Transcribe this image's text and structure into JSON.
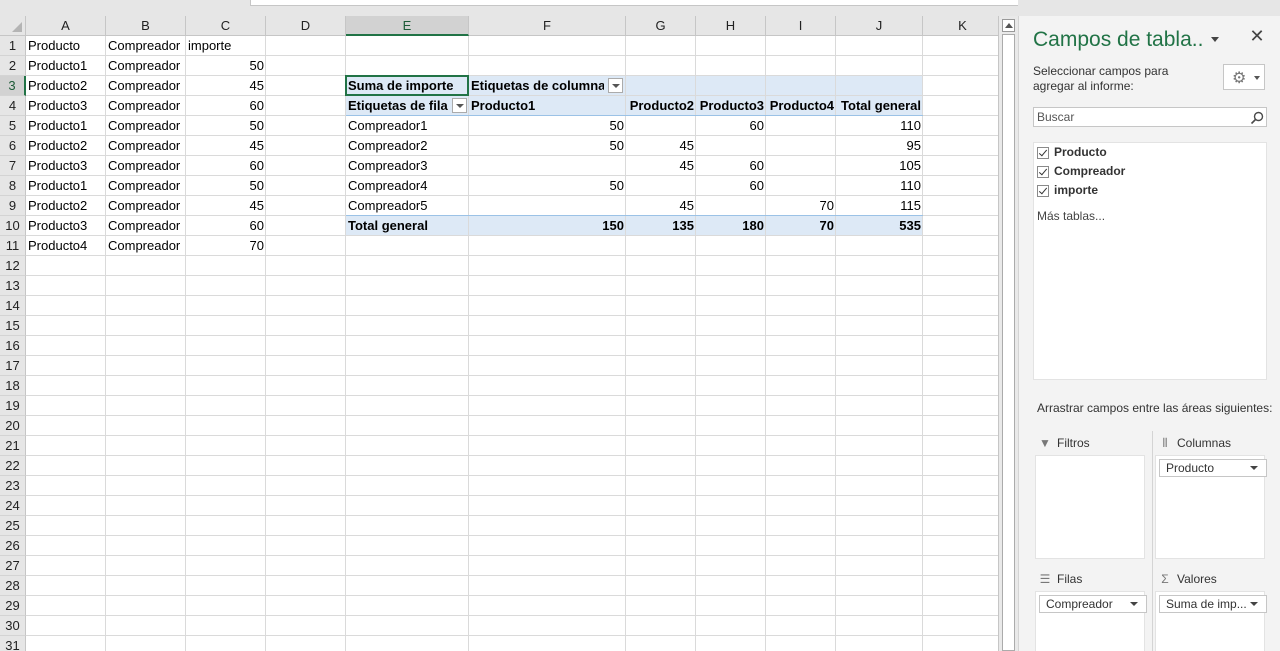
{
  "sheet": {
    "column_headers": [
      "A",
      "B",
      "C",
      "D",
      "E",
      "F",
      "G",
      "H",
      "I",
      "J",
      "K"
    ],
    "selected_column": "E",
    "row_headers": [
      "1",
      "2",
      "3",
      "4",
      "5",
      "6",
      "7",
      "8",
      "9",
      "10",
      "11",
      "12",
      "13",
      "14",
      "15",
      "16",
      "17",
      "18",
      "19",
      "20",
      "21",
      "22",
      "23",
      "24",
      "25",
      "26",
      "27",
      "28",
      "29",
      "30",
      "31"
    ],
    "selected_row": "3",
    "source_table": {
      "headers": [
        "Producto",
        "Compreador",
        "importe"
      ],
      "rows": [
        [
          "Producto1",
          "Compreador",
          "50"
        ],
        [
          "Producto2",
          "Compreador",
          "45"
        ],
        [
          "Producto3",
          "Compreador",
          "60"
        ],
        [
          "Producto1",
          "Compreador",
          "50"
        ],
        [
          "Producto2",
          "Compreador",
          "45"
        ],
        [
          "Producto3",
          "Compreador",
          "60"
        ],
        [
          "Producto1",
          "Compreador",
          "50"
        ],
        [
          "Producto2",
          "Compreador",
          "45"
        ],
        [
          "Producto3",
          "Compreador",
          "60"
        ],
        [
          "Producto4",
          "Compreador",
          "70"
        ]
      ]
    },
    "pivot": {
      "value_label": "Suma de importe",
      "col_labels_label": "Etiquetas de columna",
      "row_labels_label": "Etiquetas de fila",
      "col_headers": [
        "Producto1",
        "Producto2",
        "Producto3",
        "Producto4",
        "Total general"
      ],
      "rows": [
        {
          "label": "Compreador1",
          "values": [
            "50",
            "",
            "60",
            "",
            "110"
          ]
        },
        {
          "label": "Compreador2",
          "values": [
            "50",
            "45",
            "",
            "",
            "95"
          ]
        },
        {
          "label": "Compreador3",
          "values": [
            "",
            "45",
            "60",
            "",
            "105"
          ]
        },
        {
          "label": "Compreador4",
          "values": [
            "50",
            "",
            "60",
            "",
            "110"
          ]
        },
        {
          "label": "Compreador5",
          "values": [
            "",
            "45",
            "",
            "70",
            "115"
          ]
        }
      ],
      "total": {
        "label": "Total general",
        "values": [
          "150",
          "135",
          "180",
          "70",
          "535"
        ]
      }
    }
  },
  "pane": {
    "title": "Campos de tabla..",
    "close_symbol": "✕",
    "subtitle": "Seleccionar campos para agregar al informe:",
    "gear_symbol": "⚙",
    "search_placeholder": "Buscar",
    "fields": [
      {
        "label": "Producto",
        "checked": true
      },
      {
        "label": "Compreador",
        "checked": true
      },
      {
        "label": "importe",
        "checked": true
      }
    ],
    "more_tables": "Más tablas...",
    "drag_text": "Arrastrar campos entre las áreas siguientes:",
    "areas": {
      "filters": {
        "title": "Filtros",
        "icon": "funnel-icon",
        "items": []
      },
      "columns": {
        "title": "Columnas",
        "icon": "columns-icon",
        "items": [
          "Producto"
        ]
      },
      "rows": {
        "title": "Filas",
        "icon": "rows-icon",
        "items": [
          "Compreador"
        ]
      },
      "values": {
        "title": "Valores",
        "icon": "sigma-icon",
        "items": [
          "Suma de imp..."
        ]
      }
    }
  },
  "colors": {
    "accent": "#217346",
    "pivot_band": "#dde9f6"
  }
}
